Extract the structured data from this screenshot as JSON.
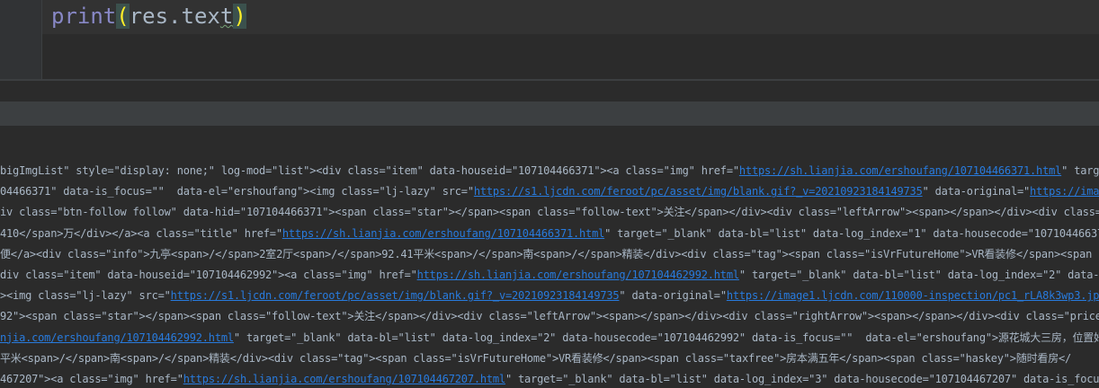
{
  "editor": {
    "code_print": "print",
    "code_open": "(",
    "code_mid": "res.tex",
    "code_last": "t",
    "code_close": ")"
  },
  "console": {
    "lines": [
      {
        "parts": [
          {
            "t": "bigImgList\" style=\"display: none;\" log-mod=\"list\"><div class=\"item\" data-houseid=\"107104466371\"><a class=\"img\" href=\""
          },
          {
            "t": "https://sh.lianjia.com/ershoufang/107104466371.html",
            "link": true
          },
          {
            "t": "\" targe"
          }
        ]
      },
      {
        "parts": [
          {
            "t": "04466371\" data-is_focus=\"\"  data-el=\"ershoufang\"><img class=\"lj-lazy\" src=\""
          },
          {
            "t": "https://s1.ljcdn.com/feroot/pc/asset/img/blank.gif?_v=20210923184149735",
            "link": true
          },
          {
            "t": "\" data-original=\""
          },
          {
            "t": "https://imag",
            "link": true
          }
        ]
      },
      {
        "parts": [
          {
            "t": "iv class=\"btn-follow follow\" data-hid=\"107104466371\"><span class=\"star\"></span><span class=\"follow-text\">关注</span></div><div class=\"leftArrow\"><span></span></div><div class=\"r"
          }
        ]
      },
      {
        "parts": [
          {
            "t": "410</span>万</div></a><a class=\"title\" href=\""
          },
          {
            "t": "https://sh.lianjia.com/ershoufang/107104466371.html",
            "link": true
          },
          {
            "t": "\" target=\"_blank\" data-bl=\"list\" data-log_index=\"1\" data-housecode=\"10710446637"
          }
        ]
      },
      {
        "parts": [
          {
            "t": "便</a><div class=\"info\">九亭<span>/</span>2室2厅<span>/</span>92.41平米<span>/</span>南<span>/</span>精装</div><div class=\"tag\"><span class=\"isVrFutureHome\">VR看装修</span><span c"
          }
        ]
      },
      {
        "parts": [
          {
            "t": "div class=\"item\" data-houseid=\"107104462992\"><a class=\"img\" href=\""
          },
          {
            "t": "https://sh.lianjia.com/ershoufang/107104462992.html",
            "link": true
          },
          {
            "t": "\" target=\"_blank\" data-bl=\"list\" data-log_index=\"2\" data-h"
          }
        ]
      },
      {
        "parts": [
          {
            "t": "><img class=\"lj-lazy\" src=\""
          },
          {
            "t": "https://s1.ljcdn.com/feroot/pc/asset/img/blank.gif?_v=20210923184149735",
            "link": true
          },
          {
            "t": "\" data-original=\""
          },
          {
            "t": "https://image1.ljcdn.com/110000-inspection/pc1_rLA8k3wp3.jpg",
            "link": true
          }
        ]
      },
      {
        "parts": [
          {
            "t": "92\"><span class=\"star\"></span><span class=\"follow-text\">关注</span></div><div class=\"leftArrow\"><span></span></div><div class=\"rightArrow\"><span></span></div><div class=\"price"
          }
        ]
      },
      {
        "parts": [
          {
            "t": "njia.com/ershoufang/107104462992.html",
            "link": true
          },
          {
            "t": "\" target=\"_blank\" data-bl=\"list\" data-log_index=\"2\" data-housecode=\"107104462992\" data-is_focus=\"\"  data-el=\"ershoufang\">源花城大三房，位置好"
          }
        ]
      },
      {
        "parts": [
          {
            "t": "平米<span>/</span>南<span>/</span>精装</div><div class=\"tag\"><span class=\"isVrFutureHome\">VR看装修</span><span class=\"taxfree\">房本满五年</span><span class=\"haskey\">随时看房</"
          }
        ]
      },
      {
        "parts": [
          {
            "t": "467207\"><a class=\"img\" href=\""
          },
          {
            "t": "https://sh.lianjia.com/ershoufang/107104467207.html",
            "link": true
          },
          {
            "t": "\" target=\"_blank\" data-bl=\"list\" data-log_index=\"3\" data-housecode=\"107104467207\" data-is_focus"
          }
        ]
      }
    ]
  }
}
